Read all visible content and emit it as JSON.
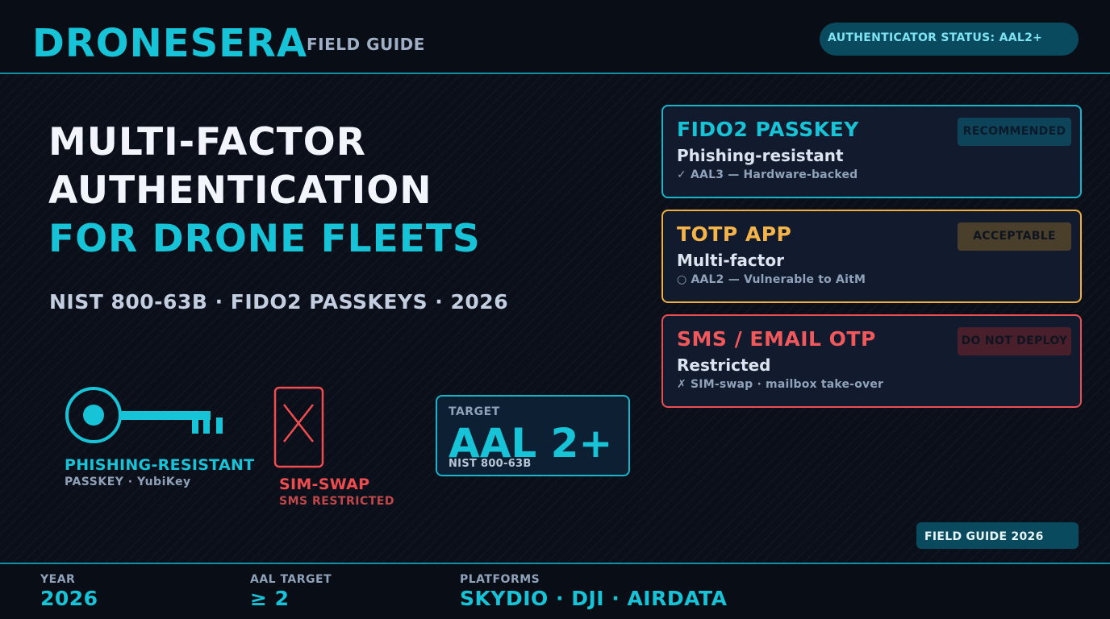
{
  "header": {
    "brand": "DRONESERA",
    "subtitle": "FIELD GUIDE",
    "status_pill": "AUTHENTICATOR STATUS: AAL2+"
  },
  "hero": {
    "line1": "MULTI-FACTOR",
    "line2": "AUTHENTICATION",
    "line3": "FOR DRONE FLEETS",
    "subline": "NIST 800-63B · FIDO2 PASSKEYS · 2026"
  },
  "illustrations": {
    "phishing_resistant": {
      "title": "PHISHING-RESISTANT",
      "subtitle": "PASSKEY · YubiKey",
      "icon": "key-icon"
    },
    "sim_swap": {
      "title": "SIM-SWAP",
      "subtitle": "SMS RESTRICTED",
      "icon": "crossed-phone-icon"
    }
  },
  "target": {
    "label": "TARGET",
    "value": "AAL 2+",
    "source": "NIST 800-63B"
  },
  "cards": [
    {
      "title": "FIDO2 PASSKEY",
      "subtitle": "Phishing-resistant",
      "note": "✓ AAL3 — Hardware-backed",
      "badge": "RECOMMENDED",
      "accent": "#17c3d6"
    },
    {
      "title": "TOTP APP",
      "subtitle": "Multi-factor",
      "note": "○ AAL2 — Vulnerable to AitM",
      "badge": "ACCEPTABLE",
      "accent": "#f5b44a"
    },
    {
      "title": "SMS / EMAIL OTP",
      "subtitle": "Restricted",
      "note": "✗ SIM-swap · mailbox take-over",
      "badge": "DO NOT DEPLOY",
      "accent": "#f0585c"
    }
  ],
  "field_guide_pill": "FIELD GUIDE 2026",
  "footer": {
    "stats": [
      {
        "label": "YEAR",
        "value": "2026"
      },
      {
        "label": "AAL TARGET",
        "value": "≥ 2"
      },
      {
        "label": "PLATFORMS",
        "value": "SKYDIO · DJI · AIRDATA"
      }
    ]
  }
}
